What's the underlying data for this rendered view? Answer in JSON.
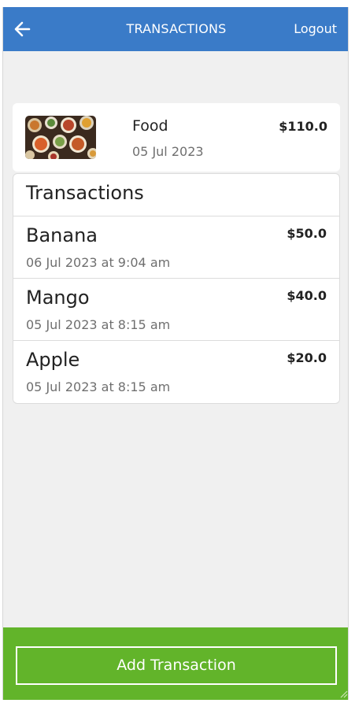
{
  "navbar": {
    "back_icon": "arrow-left-icon",
    "title": "TRANSACTIONS",
    "logout_label": "Logout",
    "color": "#3a7bc8"
  },
  "category": {
    "name": "Food",
    "date": "05 Jul 2023",
    "total": "$110.0",
    "thumbnail_icon": "food-photo"
  },
  "transactions": {
    "header": "Transactions",
    "items": [
      {
        "name": "Banana",
        "time": "06 Jul 2023 at 9:04 am",
        "amount": "$50.0"
      },
      {
        "name": "Mango",
        "time": "05 Jul 2023 at 8:15 am",
        "amount": "$40.0"
      },
      {
        "name": "Apple",
        "time": "05 Jul 2023 at 8:15 am",
        "amount": "$20.0"
      }
    ]
  },
  "footer": {
    "add_button_label": "Add Transaction",
    "color": "#62b42a"
  }
}
